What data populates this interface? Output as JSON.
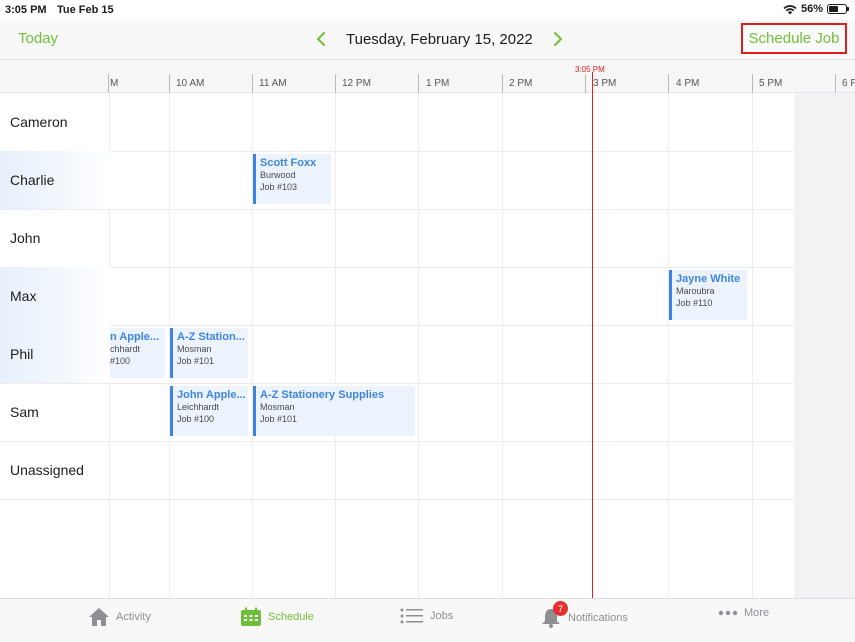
{
  "status_bar": {
    "time": "3:05 PM",
    "date": "Tue Feb 15",
    "battery": "56%"
  },
  "nav": {
    "today_label": "Today",
    "date_title": "Tuesday, February 15, 2022",
    "schedule_job_label": "Schedule Job"
  },
  "timeline": {
    "hours": [
      "M",
      "10 AM",
      "11 AM",
      "12 PM",
      "1 PM",
      "2 PM",
      "3 PM",
      "4 PM",
      "5 PM",
      "6 P"
    ],
    "now_label": "3:05 PM"
  },
  "rows": [
    {
      "name": "Cameron"
    },
    {
      "name": "Charlie"
    },
    {
      "name": "John"
    },
    {
      "name": "Max"
    },
    {
      "name": "Phil"
    },
    {
      "name": "Sam"
    },
    {
      "name": "Unassigned"
    }
  ],
  "jobs": {
    "charlie_1": {
      "title": "Scott Foxx",
      "suburb": "Burwood",
      "number": "Job #103"
    },
    "max_1": {
      "title": "Jayne White",
      "suburb": "Maroubra",
      "number": "Job #110"
    },
    "phil_1": {
      "title": "n Apple...",
      "suburb": "chhardt",
      "number": "#100"
    },
    "phil_2": {
      "title": "A-Z Station...",
      "suburb": "Mosman",
      "number": "Job #101"
    },
    "sam_1": {
      "title": "John Apple...",
      "suburb": "Leichhardt",
      "number": "Job #100"
    },
    "sam_2": {
      "title": "A-Z Stationery Supplies",
      "suburb": "Mosman",
      "number": "Job #101"
    }
  },
  "tabs": [
    {
      "label": "Activity",
      "icon": "home-icon"
    },
    {
      "label": "Schedule",
      "icon": "calendar-icon"
    },
    {
      "label": "Jobs",
      "icon": "list-icon"
    },
    {
      "label": "Notifications",
      "icon": "bell-icon",
      "badge": "7"
    },
    {
      "label": "More",
      "icon": "more-icon"
    }
  ],
  "colors": {
    "accent": "#6fbf3a",
    "job_blue": "#3d86e0",
    "now_red": "#e02020",
    "highlight_border": "#e01c1c"
  }
}
